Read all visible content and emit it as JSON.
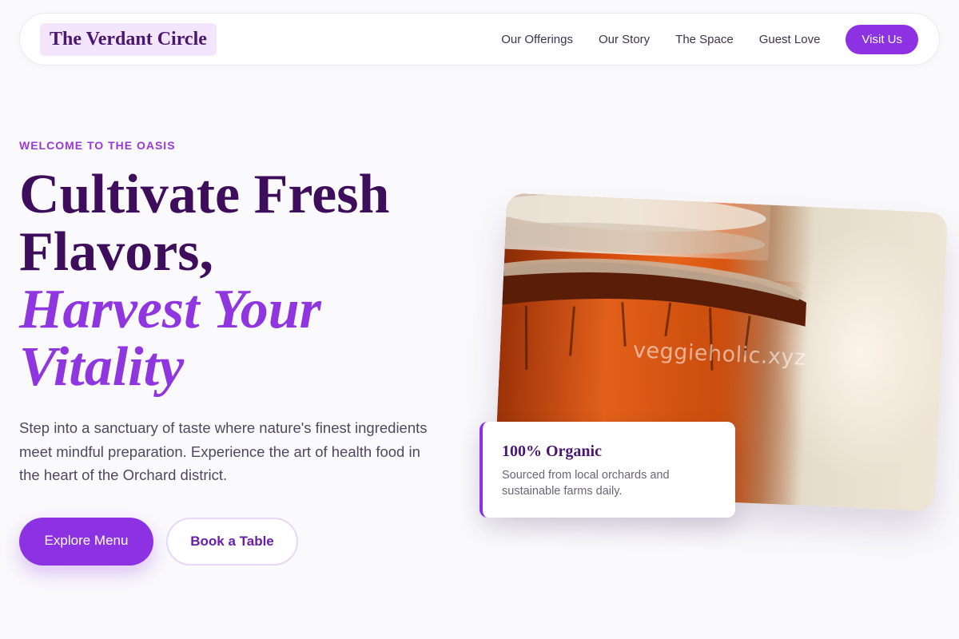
{
  "nav": {
    "brand": "The Verdant Circle",
    "links": [
      "Our Offerings",
      "Our Story",
      "The Space",
      "Guest Love"
    ],
    "cta": "Visit Us"
  },
  "hero": {
    "eyebrow": "WELCOME TO THE OASIS",
    "headline": {
      "line1": "Cultivate Fresh",
      "line2": "Flavors,",
      "accent_line1": "Harvest Your",
      "accent_line2": "Vitality"
    },
    "lede": "Step into a sanctuary of taste where nature's finest ingredients meet mindful preparation. Experience the art of health food in the heart of the Orchard district.",
    "primary_cta": "Explore Menu",
    "secondary_cta": "Book a Table"
  },
  "image": {
    "watermark": "veggieholic.xyz"
  },
  "badge": {
    "title": "100% Organic",
    "text": "Sourced from local orchards and sustainable farms daily."
  },
  "colors": {
    "accent": "#8d32e2",
    "headline": "#3e0e5d",
    "brand_bg": "#f3e5fb",
    "page_bg": "#fafafc"
  }
}
